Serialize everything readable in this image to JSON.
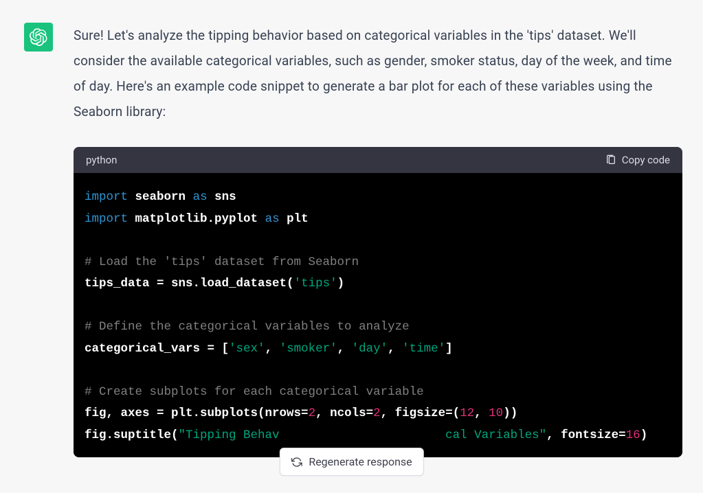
{
  "message": {
    "prose": "Sure! Let's analyze the tipping behavior based on categorical variables in the 'tips' dataset. We'll consider the available categorical variables, such as gender, smoker status, day of the week, and time of day. Here's an example code snippet to generate a bar plot for each of these variables using the Seaborn library:"
  },
  "code": {
    "lang": "python",
    "copy_label": "Copy code",
    "tokens": {
      "kw_import": "import",
      "kw_as": "as",
      "mod_seaborn": "seaborn",
      "alias_sns": "sns",
      "mod_mpl": "matplotlib.pyplot",
      "alias_plt": "plt",
      "cmt_load": "# Load the 'tips' dataset from Seaborn",
      "id_tips": "tips_data",
      "op_eq": " = ",
      "call_sns": "sns.load_dataset(",
      "str_tips": "'tips'",
      "close_paren": ")",
      "cmt_define": "# Define the categorical variables to analyze",
      "id_catvars": "categorical_vars",
      "open_list": " = [",
      "str_sex": "'sex'",
      "str_smoker": "'smoker'",
      "str_day": "'day'",
      "str_time": "'time'",
      "close_list": "]",
      "comma": ", ",
      "cmt_subplots": "# Create subplots for each categorical variable",
      "line_fig_pre": "fig, axes = plt.subplots(nrows=",
      "num_2a": "2",
      "mid_ncols": ", ncols=",
      "num_2b": "2",
      "mid_figsize": ", figsize=(",
      "num_12": "12",
      "num_10_mid": ", ",
      "num_10": "10",
      "fig_close": "))",
      "line_suptitle_pre": "fig.suptitle(",
      "str_title_a": "\"Tipping Behav",
      "str_title_b": "cal Variables\"",
      "suptitle_mid": ", fontsize=",
      "num_16": "16",
      "suptitle_close": ")"
    }
  },
  "regen": {
    "label": "Regenerate response"
  }
}
